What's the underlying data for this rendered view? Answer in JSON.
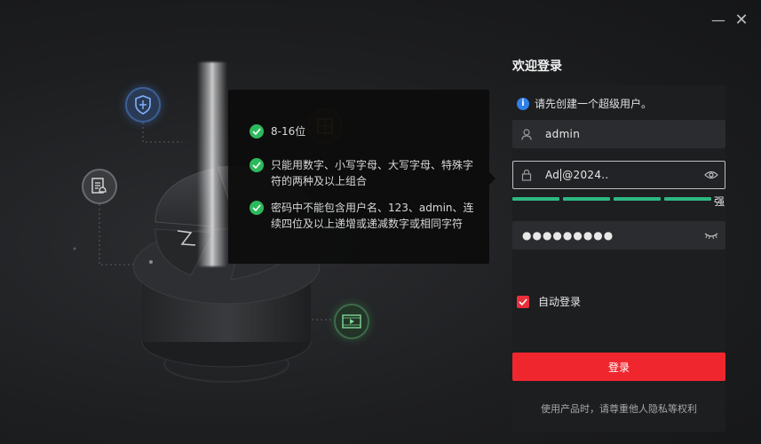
{
  "window": {
    "minimize_glyph": "—",
    "close_glyph": "✕"
  },
  "illustration": {
    "icons": [
      "shield-icon",
      "document-bell-icon",
      "video-icon",
      "grid-icon"
    ],
    "colors": {
      "beam": "#ffffff",
      "shield": "#3d5f95",
      "video": "#3e6b48"
    }
  },
  "tooltip": {
    "rules": [
      {
        "text": "8-16位",
        "status": "passed"
      },
      {
        "text": "只能用数字、小写字母、大写字母、特殊字符的两种及以上组合",
        "status": "passed"
      },
      {
        "text": "密码中不能包含用户名、123、admin、连续四位及以上递增或递减数字或相同字符",
        "status": "passed"
      }
    ]
  },
  "login": {
    "title": "欢迎登录",
    "info": "请先创建一个超级用户。",
    "username": {
      "value": "admin",
      "icon": "user-icon"
    },
    "password": {
      "value_before_caret": "Ad",
      "value_after_caret": "@2024..",
      "icon": "lock-icon",
      "toggle_icon": "eye-icon"
    },
    "strength": {
      "segments": 4,
      "filled": 4,
      "label": "强",
      "color": "#2eb882"
    },
    "confirm_password": {
      "masked_value": "●●●●●●●●●",
      "toggle_icon": "eye-closed-icon"
    },
    "auto_login": {
      "label": "自动登录",
      "checked": true
    },
    "submit_label": "登录",
    "privacy_notice": "使用产品时，请尊重他人隐私等权利",
    "accent": "#f0262f"
  }
}
